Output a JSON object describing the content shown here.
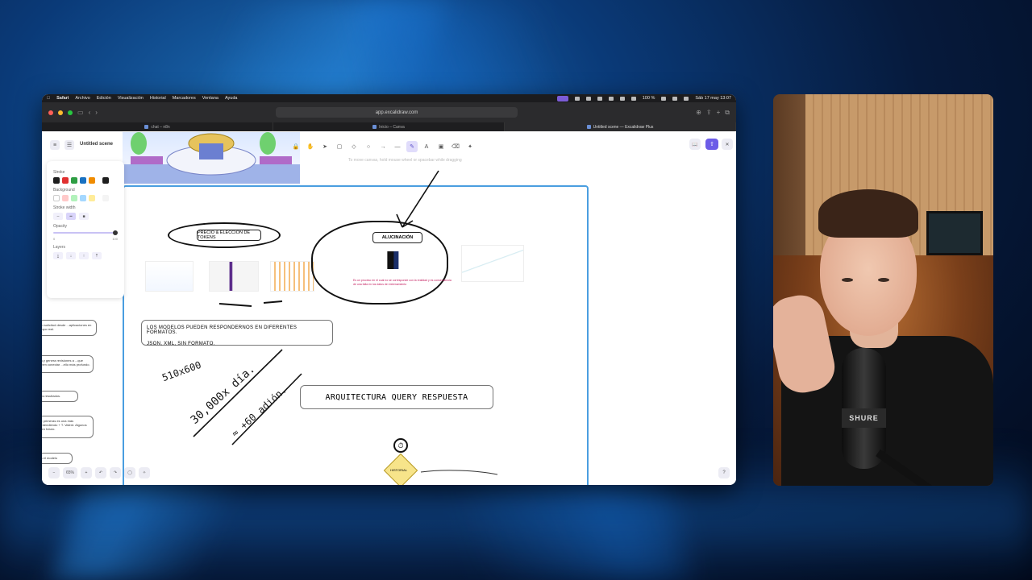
{
  "menubar": {
    "app": "Safari",
    "items": [
      "Archivo",
      "Edición",
      "Visualización",
      "Historial",
      "Marcadores",
      "Ventana",
      "Ayuda"
    ],
    "battery": "100 %",
    "datetime": "Sáb 17 may 13:07"
  },
  "browser": {
    "url": "app.excalidraw.com",
    "tabs": [
      {
        "label": "chat – n8n",
        "active": false
      },
      {
        "label": "Inicio – Canva",
        "active": false
      },
      {
        "label": "Untitled scene — Excalidraw Plus",
        "active": true
      }
    ]
  },
  "excalidraw": {
    "scene_title": "Untitled scene",
    "hint": "To move canvas, hold mouse wheel or spacebar while dragging",
    "properties": {
      "stroke_label": "Stroke",
      "background_label": "Background",
      "stroke_width_label": "Stroke width",
      "opacity_label": "Opacity",
      "opacity_min": "0",
      "opacity_max": "100",
      "layers_label": "Layers",
      "stroke_colors": [
        "#1e1e1e",
        "#e03131",
        "#2f9e44",
        "#1971c2",
        "#f08c00"
      ],
      "stroke_selected": "#1e1e1e",
      "background_colors": [
        "#ffffff",
        "#ffc9c9",
        "#b2f2bb",
        "#a5d8ff",
        "#ffec99"
      ]
    },
    "zoom": "65%",
    "canvas": {
      "top_pill": "PRECIO & ELECCIÓN DE TOKENS",
      "alucinacion": "ALUCINACIÓN",
      "red_note": "Es un proceso en el cual no se corresponde con la realidad y es consecuencia de una falla en los datos de entrenamiento",
      "formats_line1": "LOS MODELOS PUEDEN RESPONDERNOS EN DIFERENTES FORMATOS.",
      "formats_line2": "JSON, XML, SIN FORMATO.",
      "hand1": "510x600",
      "hand2": "30,000x día.",
      "hand3": "≈ +60 adión.",
      "arquitectura": "ARQUITECTURA QUERY RESPUESTA",
      "historial": "HISTORIAL",
      "side_notes": [
        "...un solicitud desde ...aplicaciones en tiempo real.",
        "...ta y genera revisiones a ...que suelen conectar ...ello más profundo.",
        "...los resultados.",
        "...te primeras es una más ...entendiendo + T. Valent. Algunos ...I en futuro.",
        "...to el modelo"
      ]
    }
  },
  "webcam": {
    "mic_brand": "SHURE"
  }
}
